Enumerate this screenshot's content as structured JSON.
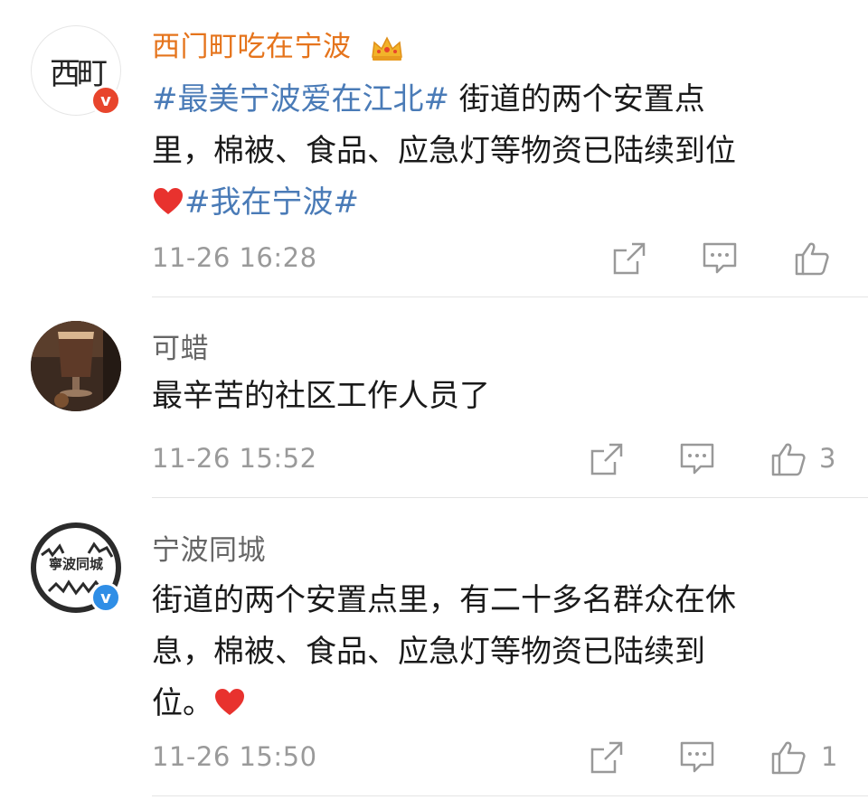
{
  "comments": [
    {
      "username": "西门町吃在宁波",
      "avatar_glyph": "西町",
      "topic1": "#最美宁波爱在江北#",
      "text1": " 街道的两个安置点",
      "text2": "里，棉被、食品、应急灯等物资已陆续到位",
      "topic2": "#我在宁波#",
      "time": "11-26 16:28",
      "likes": ""
    },
    {
      "username": "可蜡",
      "text1": "最辛苦的社区工作人员了",
      "time": "11-26 15:52",
      "likes": "3"
    },
    {
      "username": "宁波同城",
      "avatar_glyph": "寧波同城",
      "text1": "街道的两个安置点里，有二十多名群众在休",
      "text2": "息，棉被、食品、应急灯等物资已陆续到",
      "text3": "位。",
      "time": "11-26 15:50",
      "likes": "1"
    }
  ],
  "colors": {
    "vip_name": "#e5741c",
    "topic": "#4a7bb7",
    "meta": "#9a9a9a",
    "badge_red": "#e8452c",
    "badge_blue": "#2f8ee6",
    "heart": "#e8322e"
  },
  "icons": [
    "crown-icon",
    "heart-icon",
    "share-icon",
    "comment-icon",
    "like-icon",
    "verified-badge-icon"
  ]
}
